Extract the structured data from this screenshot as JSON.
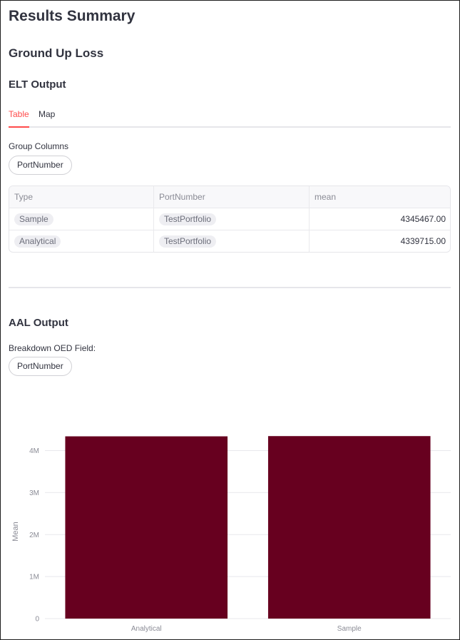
{
  "page": {
    "title": "Results Summary",
    "subtitle": "Ground Up Loss"
  },
  "elt": {
    "heading": "ELT Output",
    "tabs": [
      {
        "label": "Table",
        "active": true
      },
      {
        "label": "Map",
        "active": false
      }
    ],
    "group_columns_label": "Group Columns",
    "group_columns_value": "PortNumber",
    "table": {
      "columns": [
        "Type",
        "PortNumber",
        "mean"
      ],
      "rows": [
        [
          "Sample",
          "TestPortfolio",
          "4345467.00"
        ],
        [
          "Analytical",
          "TestPortfolio",
          "4339715.00"
        ]
      ]
    }
  },
  "aal": {
    "heading": "AAL Output",
    "breakdown_label": "Breakdown OED Field:",
    "breakdown_value": "PortNumber"
  },
  "colors": {
    "accent": "#ff4b4b",
    "bar": "#67001f"
  },
  "chart_data": {
    "type": "bar",
    "categories": [
      "Analytical",
      "Sample"
    ],
    "values": [
      4339715,
      4345467
    ],
    "ylabel": "Mean",
    "xlabel": "",
    "ylim": [
      0,
      4400000
    ],
    "yticks": [
      0,
      1000000,
      2000000,
      3000000,
      4000000
    ],
    "ytick_labels": [
      "0",
      "1M",
      "2M",
      "3M",
      "4M"
    ],
    "grid": true
  }
}
